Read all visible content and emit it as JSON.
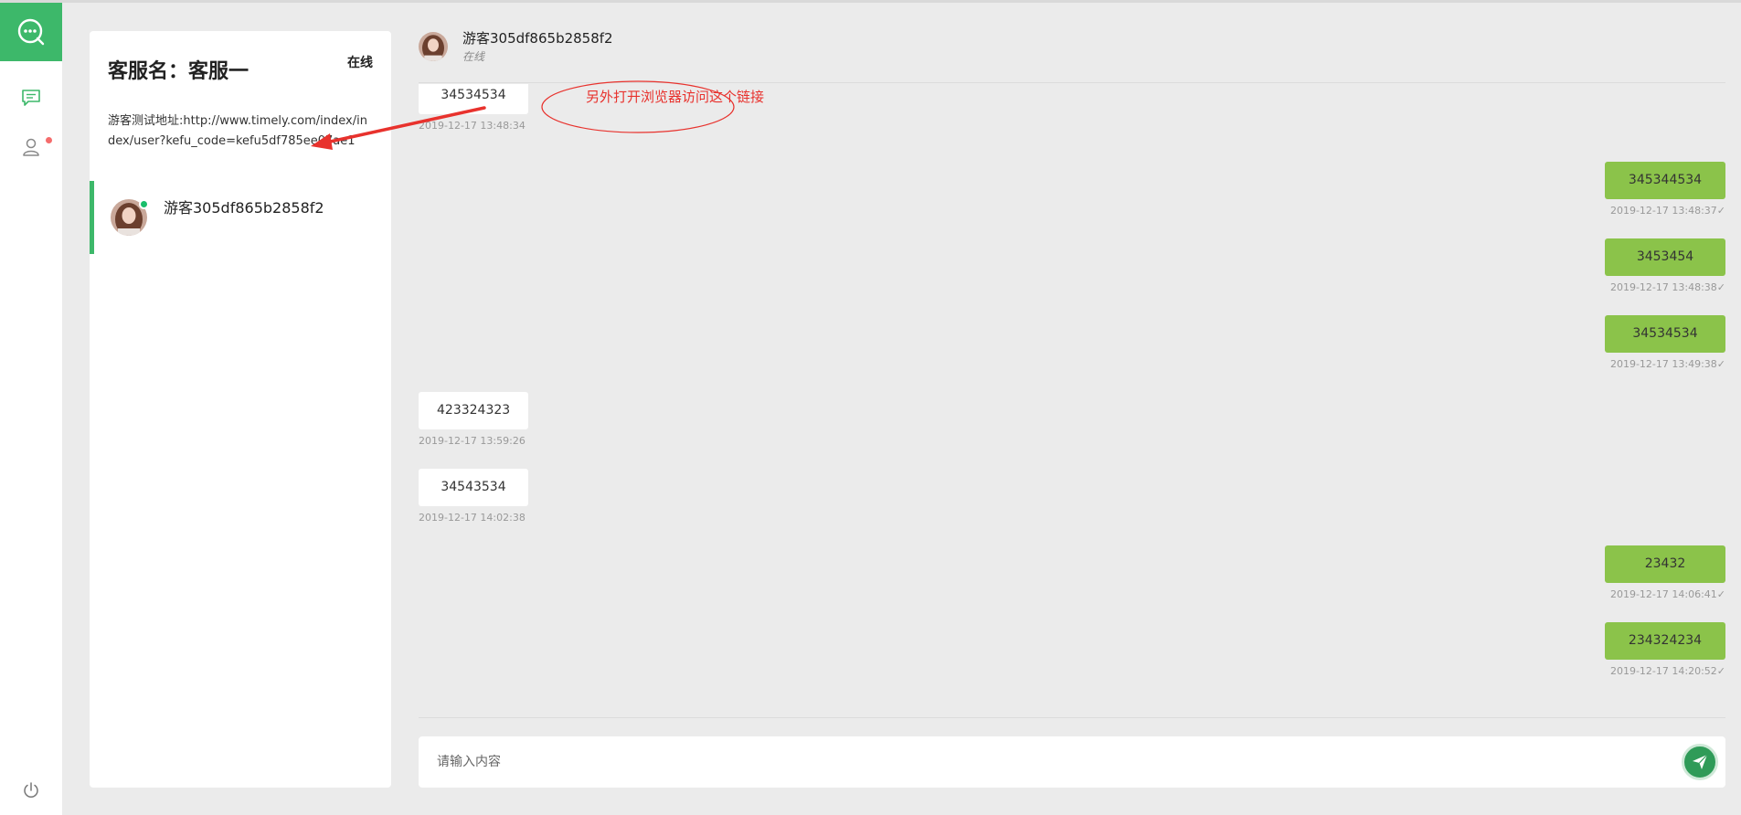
{
  "panel": {
    "title": "客服名：客服一",
    "status": "在线",
    "test_link": "游客测试地址:http://www.timely.com/index/index/user?kefu_code=kefu5df785ee07ae1"
  },
  "contacts": [
    {
      "name": "游客305df865b2858f2",
      "online": true
    }
  ],
  "chat_header": {
    "name": "游客305df865b2858f2",
    "status": "在线"
  },
  "messages": [
    {
      "direction": "in",
      "text": "34534534",
      "time": "2019-12-17 13:48:34"
    },
    {
      "direction": "out",
      "text": "345344534",
      "time": "2019-12-17 13:48:37",
      "check": "✓"
    },
    {
      "direction": "out",
      "text": "3453454",
      "time": "2019-12-17 13:48:38",
      "check": "✓"
    },
    {
      "direction": "out",
      "text": "34534534",
      "time": "2019-12-17 13:49:38",
      "check": "✓"
    },
    {
      "direction": "in",
      "text": "423324323",
      "time": "2019-12-17 13:59:26"
    },
    {
      "direction": "in",
      "text": "34543534",
      "time": "2019-12-17 14:02:38"
    },
    {
      "direction": "out",
      "text": "23432",
      "time": "2019-12-17 14:06:41",
      "check": "✓"
    },
    {
      "direction": "out",
      "text": "234324234",
      "time": "2019-12-17 14:20:52",
      "check": "✓"
    }
  ],
  "annotation": {
    "text": "另外打开浏览器访问这个链接",
    "color": "#e8322d"
  },
  "input": {
    "placeholder": "请输入内容"
  },
  "colors": {
    "brand": "#3db86a",
    "out_bubble": "#8bc34a",
    "badge": "#f56c6c",
    "online": "#19be6b"
  },
  "icons": {
    "logo": "chat-bubble-icon",
    "chat_nav": "message-icon",
    "user_nav": "user-icon",
    "logout": "power-icon",
    "send": "paper-plane-icon"
  }
}
